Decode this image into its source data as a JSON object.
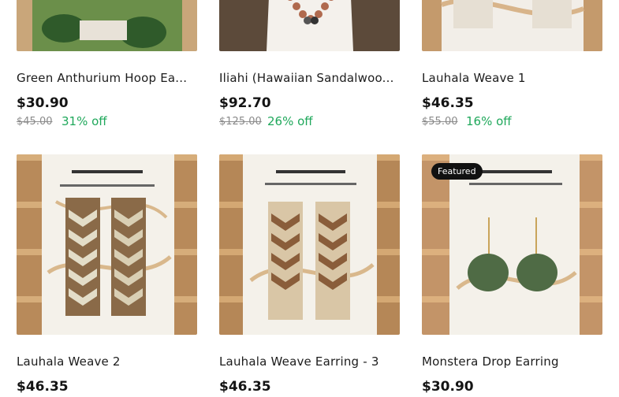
{
  "products": [
    {
      "title": "Green Anthurium Hoop Ea...",
      "price": "$30.90",
      "original_price": "$45.00",
      "discount": "31% off"
    },
    {
      "title": "Iliahi (Hawaiian Sandalwoo...",
      "price": "$92.70",
      "original_price": "$125.00",
      "discount": "26% off"
    },
    {
      "title": "Lauhala Weave 1",
      "price": "$46.35",
      "original_price": "$55.00",
      "discount": "16% off"
    },
    {
      "title": "Lauhala Weave 2",
      "price": "$46.35"
    },
    {
      "title": "Lauhala Weave Earring - 3",
      "price": "$46.35"
    },
    {
      "title": "Monstera Drop Earring",
      "price": "$30.90",
      "badge": "Featured"
    }
  ],
  "colors": {
    "discount": "#1fa85b",
    "badge_bg": "#111111"
  }
}
